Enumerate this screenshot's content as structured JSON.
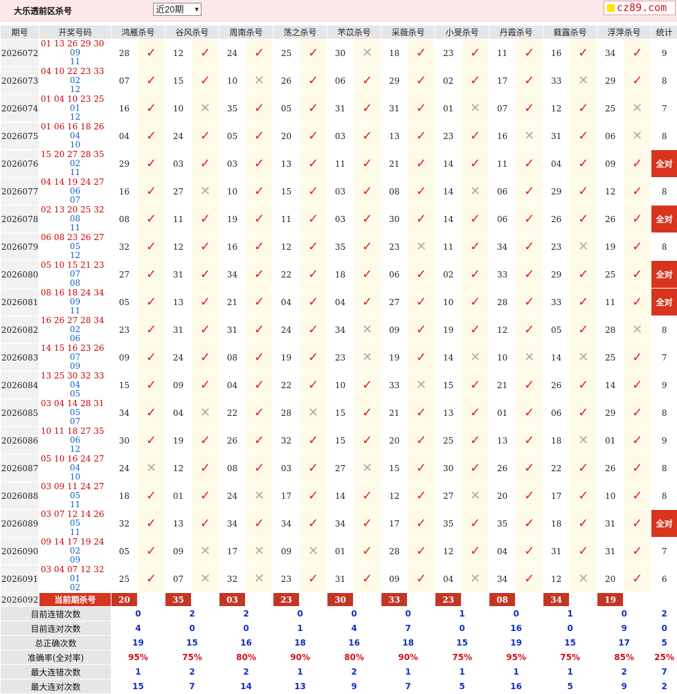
{
  "header": {
    "title": "大乐透前区杀号",
    "period_select": "近20期",
    "logo_text": "cz89.com"
  },
  "columns": {
    "period": "期号",
    "draw": "开奖号码",
    "experts": [
      "鸿雁杀号",
      "谷风杀号",
      "周南杀号",
      "荡之杀号",
      "芣苡杀号",
      "采薇杀号",
      "小旻杀号",
      "丹霞杀号",
      "蕤露杀号",
      "浮萍杀号"
    ],
    "stat": "统计"
  },
  "rows": [
    {
      "period": "2026072",
      "front": "01 13 26 29 30",
      "back": [
        "09",
        "11"
      ],
      "kills": [
        "28",
        "12",
        "24",
        "25",
        "30",
        "18",
        "23",
        "11",
        "16",
        "34"
      ],
      "ok": [
        1,
        1,
        1,
        1,
        0,
        1,
        1,
        1,
        1,
        1
      ],
      "stat": "9"
    },
    {
      "period": "2026073",
      "front": "04 10 22 23 33",
      "back": [
        "02",
        "12"
      ],
      "kills": [
        "07",
        "15",
        "10",
        "26",
        "06",
        "29",
        "02",
        "17",
        "33",
        "29"
      ],
      "ok": [
        1,
        1,
        0,
        1,
        1,
        1,
        1,
        1,
        0,
        1
      ],
      "stat": "8"
    },
    {
      "period": "2026074",
      "front": "01 04 10 23 25",
      "back": [
        "01",
        "12"
      ],
      "kills": [
        "16",
        "10",
        "35",
        "05",
        "31",
        "31",
        "01",
        "07",
        "12",
        "25"
      ],
      "ok": [
        1,
        0,
        1,
        1,
        1,
        1,
        0,
        1,
        1,
        0
      ],
      "stat": "7"
    },
    {
      "period": "2026075",
      "front": "01 06 16 18 26",
      "back": [
        "04",
        "10"
      ],
      "kills": [
        "04",
        "24",
        "05",
        "20",
        "03",
        "13",
        "23",
        "16",
        "31",
        "06"
      ],
      "ok": [
        1,
        1,
        1,
        1,
        1,
        1,
        1,
        0,
        1,
        0
      ],
      "stat": "8"
    },
    {
      "period": "2026076",
      "front": "15 20 27 28 35",
      "back": [
        "02",
        "11"
      ],
      "kills": [
        "29",
        "03",
        "03",
        "13",
        "11",
        "21",
        "14",
        "11",
        "04",
        "09"
      ],
      "ok": [
        1,
        1,
        1,
        1,
        1,
        1,
        1,
        1,
        1,
        1
      ],
      "stat": "全对"
    },
    {
      "period": "2026077",
      "front": "04 14 19 24 27",
      "back": [
        "06",
        "07"
      ],
      "kills": [
        "16",
        "27",
        "10",
        "15",
        "03",
        "08",
        "14",
        "06",
        "29",
        "12"
      ],
      "ok": [
        1,
        0,
        1,
        1,
        1,
        1,
        0,
        1,
        1,
        1
      ],
      "stat": "8"
    },
    {
      "period": "2026078",
      "front": "02 13 20 25 32",
      "back": [
        "08",
        "11"
      ],
      "kills": [
        "08",
        "11",
        "19",
        "11",
        "03",
        "30",
        "14",
        "06",
        "26",
        "26"
      ],
      "ok": [
        1,
        1,
        1,
        1,
        1,
        1,
        1,
        1,
        1,
        1
      ],
      "stat": "全对"
    },
    {
      "period": "2026079",
      "front": "06 08 23 26 27",
      "back": [
        "05",
        "12"
      ],
      "kills": [
        "32",
        "12",
        "16",
        "12",
        "35",
        "23",
        "11",
        "34",
        "23",
        "19"
      ],
      "ok": [
        1,
        1,
        1,
        1,
        1,
        0,
        1,
        1,
        0,
        1
      ],
      "stat": "8"
    },
    {
      "period": "2026080",
      "front": "05 10 15 21 23",
      "back": [
        "07",
        "08"
      ],
      "kills": [
        "27",
        "31",
        "34",
        "22",
        "18",
        "06",
        "02",
        "33",
        "29",
        "25"
      ],
      "ok": [
        1,
        1,
        1,
        1,
        1,
        1,
        1,
        1,
        1,
        1
      ],
      "stat": "全对"
    },
    {
      "period": "2026081",
      "front": "08 16 18 24 34",
      "back": [
        "09",
        "11"
      ],
      "kills": [
        "05",
        "13",
        "21",
        "04",
        "04",
        "27",
        "10",
        "28",
        "33",
        "11"
      ],
      "ok": [
        1,
        1,
        1,
        1,
        1,
        1,
        1,
        1,
        1,
        1
      ],
      "stat": "全对"
    },
    {
      "period": "2026082",
      "front": "16 26 27 28 34",
      "back": [
        "02",
        "06"
      ],
      "kills": [
        "23",
        "31",
        "31",
        "24",
        "34",
        "09",
        "19",
        "12",
        "05",
        "28"
      ],
      "ok": [
        1,
        1,
        1,
        1,
        0,
        1,
        1,
        1,
        1,
        0
      ],
      "stat": "8"
    },
    {
      "period": "2026083",
      "front": "14 15 16 23 26",
      "back": [
        "07",
        "09"
      ],
      "kills": [
        "09",
        "24",
        "08",
        "19",
        "23",
        "19",
        "14",
        "10",
        "14",
        "25"
      ],
      "ok": [
        1,
        1,
        1,
        1,
        0,
        1,
        0,
        0,
        0,
        1
      ],
      "stat": "7"
    },
    {
      "period": "2026084",
      "front": "13 25 30 32 33",
      "back": [
        "04",
        "05"
      ],
      "kills": [
        "15",
        "09",
        "04",
        "22",
        "10",
        "33",
        "15",
        "21",
        "26",
        "14"
      ],
      "ok": [
        1,
        1,
        1,
        1,
        1,
        0,
        1,
        1,
        1,
        1
      ],
      "stat": "9"
    },
    {
      "period": "2026085",
      "front": "03 04 14 28 31",
      "back": [
        "05",
        "07"
      ],
      "kills": [
        "34",
        "04",
        "22",
        "28",
        "15",
        "21",
        "13",
        "01",
        "06",
        "29"
      ],
      "ok": [
        1,
        0,
        1,
        0,
        1,
        1,
        1,
        1,
        1,
        1
      ],
      "stat": "8"
    },
    {
      "period": "2026086",
      "front": "10 11 18 27 35",
      "back": [
        "06",
        "12"
      ],
      "kills": [
        "30",
        "19",
        "26",
        "32",
        "15",
        "20",
        "25",
        "13",
        "18",
        "01"
      ],
      "ok": [
        1,
        1,
        1,
        1,
        1,
        1,
        1,
        1,
        0,
        1
      ],
      "stat": "9"
    },
    {
      "period": "2026087",
      "front": "05 10 16 24 27",
      "back": [
        "04",
        "10"
      ],
      "kills": [
        "24",
        "12",
        "08",
        "03",
        "27",
        "15",
        "30",
        "26",
        "22",
        "26"
      ],
      "ok": [
        0,
        1,
        1,
        1,
        0,
        1,
        1,
        1,
        1,
        1
      ],
      "stat": "8"
    },
    {
      "period": "2026088",
      "front": "03 09 11 24 27",
      "back": [
        "05",
        "11"
      ],
      "kills": [
        "18",
        "01",
        "24",
        "17",
        "14",
        "12",
        "27",
        "20",
        "17",
        "10"
      ],
      "ok": [
        1,
        1,
        0,
        1,
        1,
        1,
        0,
        1,
        1,
        1
      ],
      "stat": "8"
    },
    {
      "period": "2026089",
      "front": "03 07 12 14 26",
      "back": [
        "05",
        "11"
      ],
      "kills": [
        "32",
        "13",
        "34",
        "34",
        "34",
        "17",
        "35",
        "35",
        "18",
        "31"
      ],
      "ok": [
        1,
        1,
        1,
        1,
        1,
        1,
        1,
        1,
        1,
        1
      ],
      "stat": "全对"
    },
    {
      "period": "2026090",
      "front": "09 14 17 19 24",
      "back": [
        "02",
        "09"
      ],
      "kills": [
        "05",
        "09",
        "17",
        "09",
        "01",
        "28",
        "12",
        "04",
        "31",
        "31"
      ],
      "ok": [
        1,
        0,
        0,
        0,
        1,
        1,
        1,
        1,
        1,
        1
      ],
      "stat": "7"
    },
    {
      "period": "2026091",
      "front": "03 04 07 12 32",
      "back": [
        "01",
        "02"
      ],
      "kills": [
        "25",
        "07",
        "32",
        "23",
        "31",
        "09",
        "04",
        "34",
        "12",
        "20"
      ],
      "ok": [
        1,
        0,
        0,
        1,
        1,
        1,
        0,
        1,
        0,
        1
      ],
      "stat": "6"
    }
  ],
  "current": {
    "period": "2026092",
    "label": "当前期杀号",
    "kills": [
      "20",
      "35",
      "03",
      "23",
      "30",
      "33",
      "23",
      "08",
      "34",
      "19"
    ]
  },
  "stats": [
    {
      "label": "目前连错次数",
      "values": [
        "0",
        "2",
        "2",
        "0",
        "0",
        "0",
        "1",
        "0",
        "1",
        "0",
        "2"
      ],
      "color": "blue"
    },
    {
      "label": "目前连对次数",
      "values": [
        "4",
        "0",
        "0",
        "1",
        "4",
        "7",
        "0",
        "16",
        "0",
        "9",
        "0"
      ],
      "color": "blue"
    },
    {
      "label": "总正确次数",
      "values": [
        "19",
        "15",
        "16",
        "18",
        "16",
        "18",
        "15",
        "19",
        "15",
        "17",
        "5"
      ],
      "color": "blue"
    },
    {
      "label": "准确率(全对率)",
      "values": [
        "95%",
        "75%",
        "80%",
        "90%",
        "80%",
        "90%",
        "75%",
        "95%",
        "75%",
        "85%",
        "25%"
      ],
      "color": "red"
    },
    {
      "label": "最大连错次数",
      "values": [
        "1",
        "2",
        "2",
        "1",
        "2",
        "1",
        "1",
        "1",
        "1",
        "2",
        "7"
      ],
      "color": "blue"
    },
    {
      "label": "最大连对次数",
      "values": [
        "15",
        "7",
        "14",
        "13",
        "9",
        "7",
        "5",
        "16",
        "5",
        "9",
        "2"
      ],
      "color": "blue"
    }
  ],
  "marks": {
    "ok": "✓",
    "bad": "✕"
  }
}
